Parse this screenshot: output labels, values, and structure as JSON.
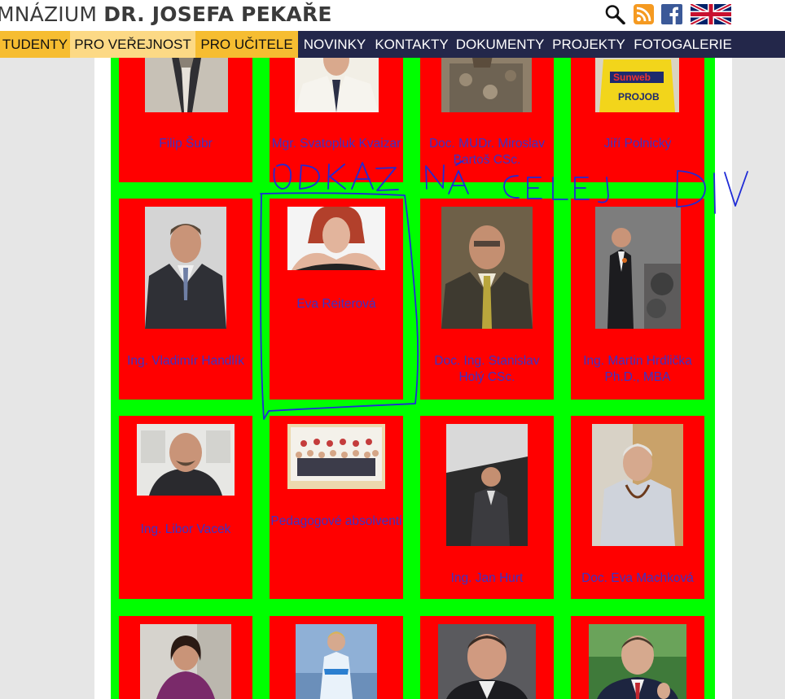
{
  "header": {
    "title_light": "MNÁZIUM ",
    "title_bold": "DR. JOSEFA PEKAŘE",
    "icons": [
      "search-icon",
      "rss-icon",
      "facebook-icon",
      "uk-flag-icon"
    ]
  },
  "nav": {
    "items": [
      {
        "label": "TUDENTY",
        "style": "yellow"
      },
      {
        "label": "PRO VEŘEJNOST",
        "style": "light"
      },
      {
        "label": "PRO UČITELE",
        "style": "yellow"
      },
      {
        "label": "NOVINKY",
        "style": "dark"
      },
      {
        "label": "KONTAKTY",
        "style": "dark"
      },
      {
        "label": "DOKUMENTY",
        "style": "dark"
      },
      {
        "label": "PROJEKTY",
        "style": "dark"
      },
      {
        "label": "FOTOGALERIE",
        "style": "dark"
      }
    ]
  },
  "cards": [
    {
      "name": "Filip Šubr"
    },
    {
      "name": "Mgr. Svatopluk Kvaizar"
    },
    {
      "name": "Doc. MUDr. Miroslav Bartoš CSc."
    },
    {
      "name": "Jiří Polnický"
    },
    {
      "name": "Ing. Vladimír Handlík"
    },
    {
      "name": "Eva Reiterová"
    },
    {
      "name": "Doc. Ing. Stanislav Holý CSc."
    },
    {
      "name": "Ing. Martin Hrdlička Ph.D., MBA"
    },
    {
      "name": "Ing. Libor Vacek"
    },
    {
      "name": "Pedagogové absolventi"
    },
    {
      "name": "Ing. Jan Hurt"
    },
    {
      "name": "Doc. Eva Machková"
    },
    {
      "name": ""
    },
    {
      "name": ""
    },
    {
      "name": ""
    },
    {
      "name": ""
    }
  ],
  "annotation": {
    "text": "ODKAZ NA CELEJ DIV",
    "color": "#1f2bd6"
  },
  "colors": {
    "grid_bg": "#00ff00",
    "card_bg": "#ff0000",
    "link_text": "#3d32c4",
    "nav_dark": "#23274a",
    "nav_yellow": "#f6bd31"
  }
}
